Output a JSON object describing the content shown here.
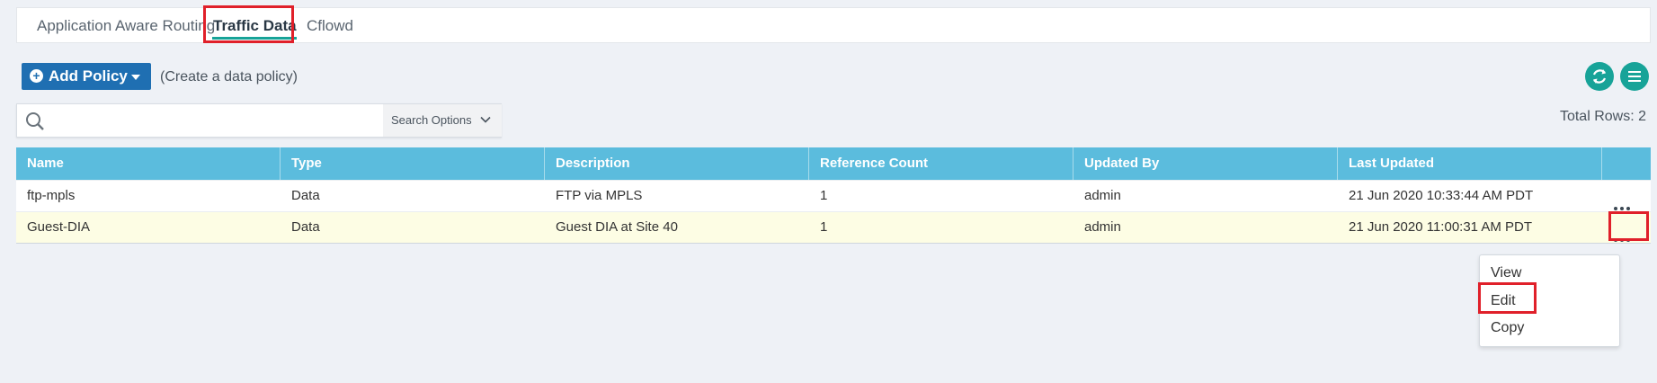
{
  "tabs": [
    {
      "label": "Application Aware Routing",
      "active": false
    },
    {
      "label": "Traffic Data",
      "active": true
    },
    {
      "label": "Cflowd",
      "active": false
    }
  ],
  "toolbar": {
    "add_policy_label": "Add Policy",
    "hint": "(Create a data policy)"
  },
  "search": {
    "placeholder": "",
    "options_label": "Search Options"
  },
  "total_rows": "Total Rows: 2",
  "table": {
    "columns": [
      "Name",
      "Type",
      "Description",
      "Reference Count",
      "Updated By",
      "Last Updated"
    ],
    "rows": [
      {
        "name": "ftp-mpls",
        "type": "Data",
        "description": "FTP via MPLS",
        "reference_count": "1",
        "updated_by": "admin",
        "last_updated": "21 Jun 2020 10:33:44 AM PDT"
      },
      {
        "name": "Guest-DIA",
        "type": "Data",
        "description": "Guest DIA at Site 40",
        "reference_count": "1",
        "updated_by": "admin",
        "last_updated": "21 Jun 2020 11:00:31 AM PDT"
      }
    ]
  },
  "context_menu": {
    "items": [
      "View",
      "Edit",
      "Copy"
    ]
  },
  "colors": {
    "accent": "#17a398",
    "primary_button": "#1f6fb2",
    "table_header": "#5bbcdd",
    "highlight": "#e0202a",
    "selected_row": "#fdfde4"
  },
  "icons": [
    "plus-circle-icon",
    "caret-down-icon",
    "refresh-icon",
    "hamburger-menu-icon",
    "search-icon",
    "chevron-down-icon",
    "more-options-icon"
  ]
}
